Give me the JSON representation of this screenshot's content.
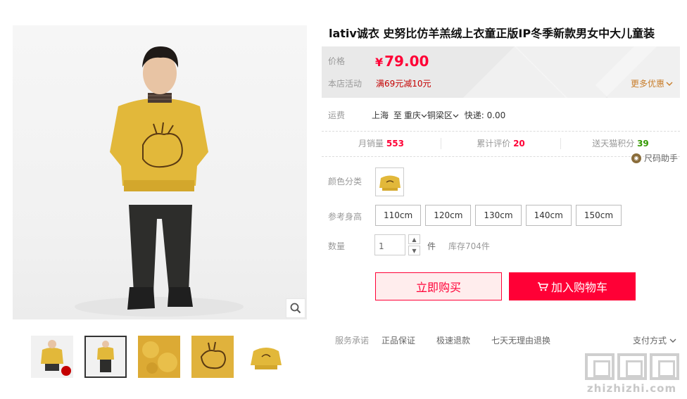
{
  "product": {
    "title": "lativ诚衣 史努比仿羊羔绒上衣童正版IP冬季新款男女中大儿童装"
  },
  "price": {
    "label": "价格",
    "currency": "¥",
    "value": "79.00",
    "promo_label": "本店活动",
    "promo_value": "满69元减10元",
    "more_promo": "更多优惠"
  },
  "shipping": {
    "label": "运费",
    "from": "上海",
    "to_word": "至",
    "city": "重庆",
    "district": "铜梁区",
    "express": "快递: 0.00"
  },
  "stats": [
    {
      "label": "月销量",
      "value": "553"
    },
    {
      "label": "累计评价",
      "value": "20"
    },
    {
      "label": "送天猫积分",
      "value": "39"
    }
  ],
  "size_helper": {
    "label": "尺码助手"
  },
  "color": {
    "label": "颜色分类"
  },
  "sizes": {
    "label": "参考身高",
    "options": [
      "110cm",
      "120cm",
      "130cm",
      "140cm",
      "150cm"
    ]
  },
  "quantity": {
    "label": "数量",
    "value": "1",
    "unit": "件",
    "stock": "库存704件",
    "up": "▲",
    "down": "▼"
  },
  "actions": {
    "buy_now": "立即购买",
    "add_cart": "加入购物车"
  },
  "service": {
    "label": "服务承诺",
    "items": [
      "正品保证",
      "极速退款",
      "七天无理由退换"
    ],
    "payment": "支付方式"
  },
  "watermark": {
    "text": "zhizhizhi.com"
  },
  "colors": {
    "accent": "#ff0036",
    "promo": "#c40000",
    "more": "#c87d2a",
    "points": "#339900",
    "sweater": "#e2b83a"
  },
  "icons": [
    "zoom-icon",
    "cart-icon",
    "chevron-down-icon",
    "size-helper-icon"
  ]
}
